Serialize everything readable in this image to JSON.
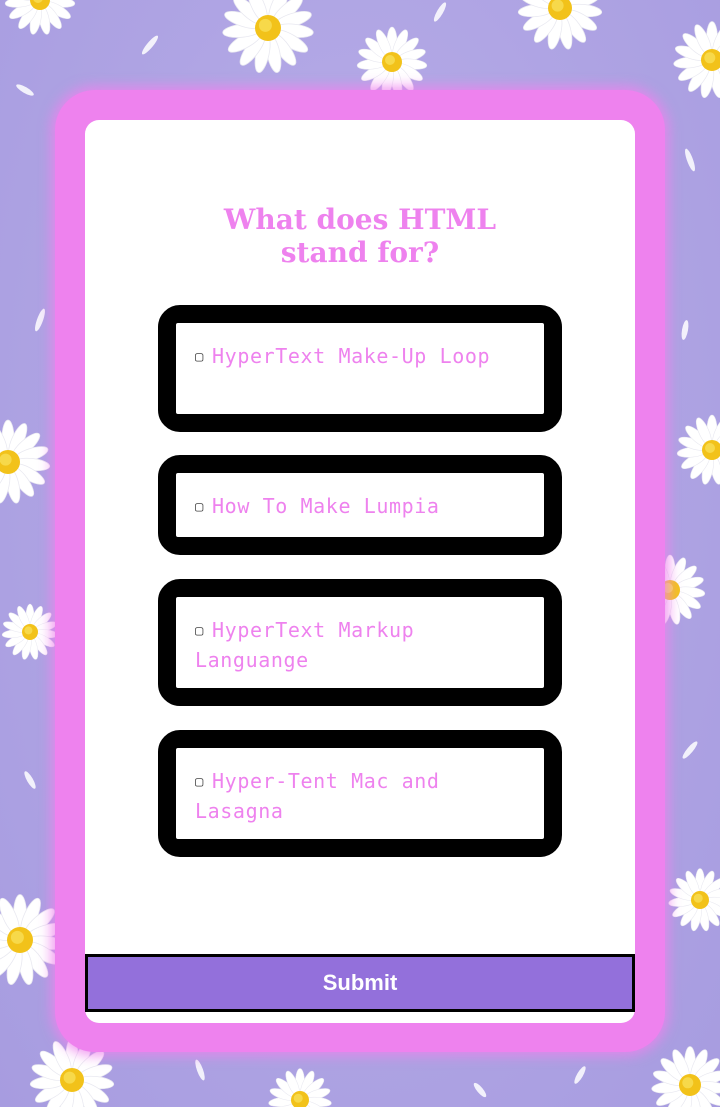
{
  "quiz": {
    "question": "What does HTML stand for?",
    "options": [
      {
        "checkbox": "▢",
        "label": "HyperText Make-Up Loop"
      },
      {
        "checkbox": "▢",
        "label": "How To Make Lumpia"
      },
      {
        "checkbox": "▢",
        "label": "HyperText Markup Languange"
      },
      {
        "checkbox": "▢",
        "label": "Hyper-Tent Mac and Lasagna"
      }
    ],
    "submit_label": "Submit"
  },
  "colors": {
    "accent": "#ee82ee",
    "submit_bg": "#9370db",
    "background": "#b3a9e6"
  }
}
